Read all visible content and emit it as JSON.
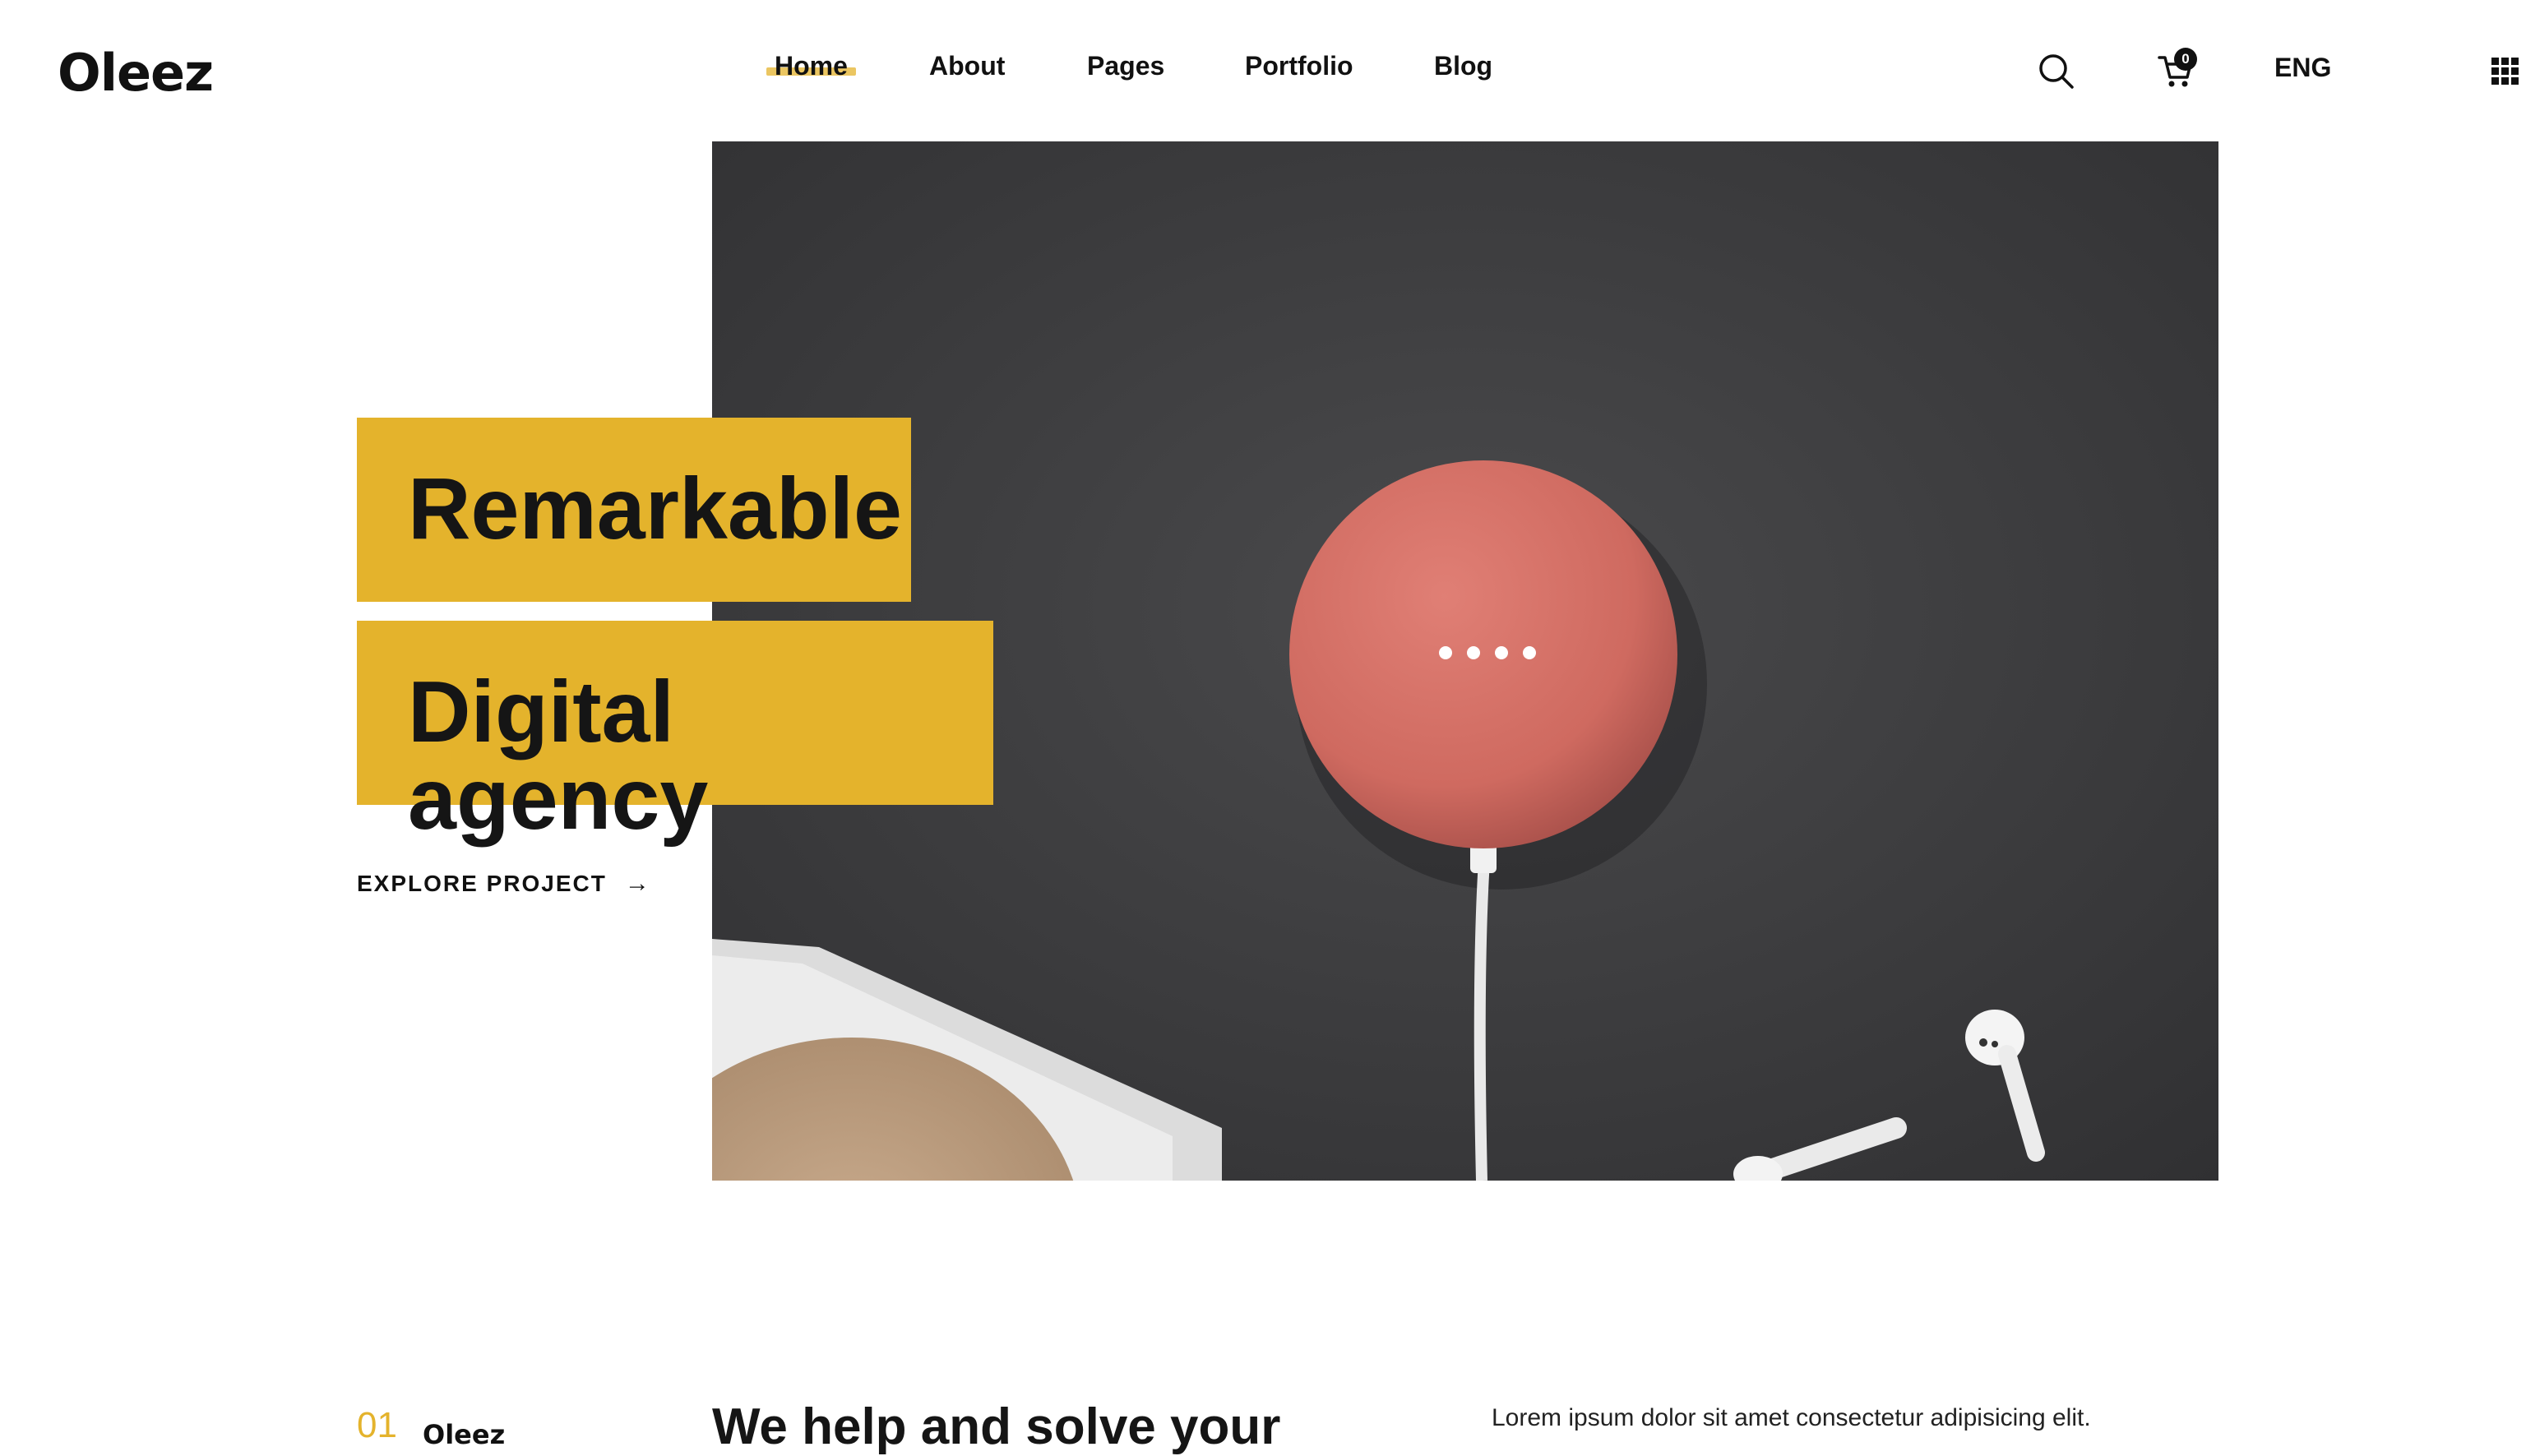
{
  "header": {
    "logo": "Oleez",
    "nav": [
      {
        "label": "Home",
        "active": true
      },
      {
        "label": "About"
      },
      {
        "label": "Pages"
      },
      {
        "label": "Portfolio"
      },
      {
        "label": "Blog"
      }
    ],
    "cart_count": "0",
    "language": "ENG",
    "icons": [
      "search-icon",
      "cart-icon",
      "grid-menu-icon"
    ]
  },
  "hero": {
    "title_line1": "Remarkable",
    "title_line2": "Digital agency",
    "cta": "EXPLORE PROJECT",
    "cta_arrow": "→",
    "image": "smart-speaker-photo"
  },
  "section": {
    "number": "01",
    "brand": "Oleez",
    "heading": "We help and solve your",
    "text": "Lorem ipsum dolor sit amet consectetur adipisicing elit."
  },
  "colors": {
    "accent": "#e4b32c",
    "text": "#111111",
    "background": "#ffffff"
  }
}
